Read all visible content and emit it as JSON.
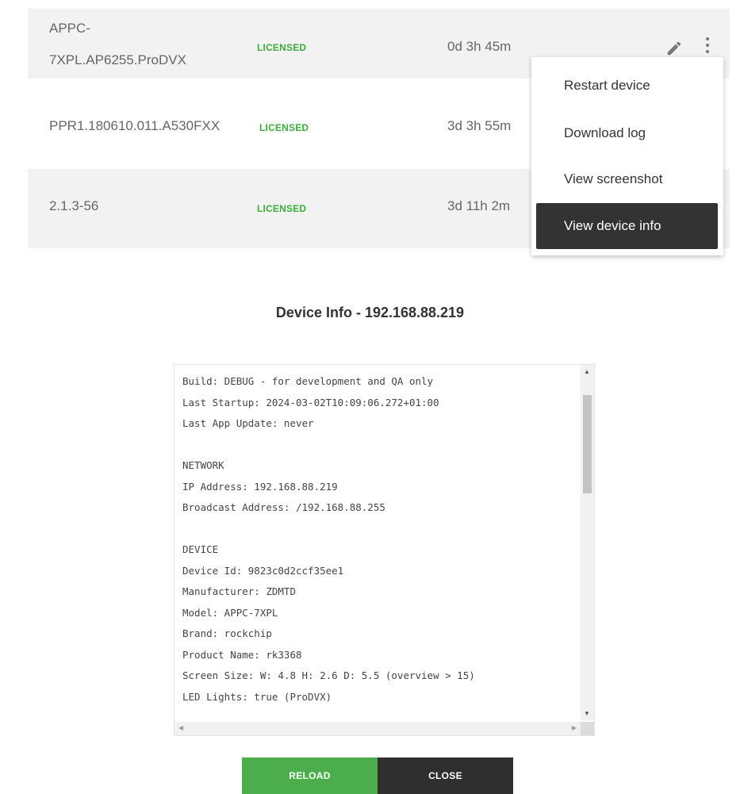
{
  "rows": [
    {
      "name_line1": "APPC-",
      "name_line2": "7XPL.AP6255.ProDVX",
      "status": "LICENSED",
      "uptime": "0d 3h 45m"
    },
    {
      "name": "PPR1.180610.011.A530FXX",
      "status": "LICENSED",
      "uptime": "3d 3h 55m"
    },
    {
      "name": "2.1.3-56",
      "status": "LICENSED",
      "uptime": "3d 11h 2m"
    }
  ],
  "menu": {
    "items": [
      "Restart device",
      "Download log",
      "View screenshot",
      "View device info"
    ]
  },
  "dialog": {
    "title": "Device Info - 192.168.88.219",
    "lines": [
      "Build: DEBUG - for development and QA only",
      "Last Startup: 2024-03-02T10:09:06.272+01:00",
      "Last App Update: never",
      "",
      "NETWORK",
      "IP Address: 192.168.88.219",
      "Broadcast Address: /192.168.88.255",
      "",
      "DEVICE",
      "Device Id: 9823c0d2ccf35ee1",
      "Manufacturer: ZDMTD",
      "Model: APPC-7XPL",
      "Brand: rockchip",
      "Product Name: rk3368",
      "Screen Size: W: 4.8 H: 2.6 D: 5.5 (overview > 15)",
      "LED Lights: true (ProDVX)"
    ],
    "reload_label": "RELOAD",
    "close_label": "CLOSE"
  },
  "colors": {
    "licensed": "#3fa93f",
    "reload": "#4cad4c",
    "close": "#2f2f2f",
    "menu_active": "#333333"
  }
}
